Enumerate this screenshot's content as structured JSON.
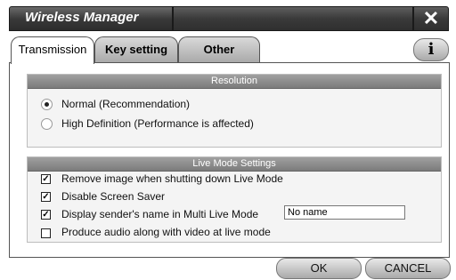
{
  "window": {
    "title": "Wireless Manager",
    "close_glyph": "✕"
  },
  "tabs": [
    {
      "label": "Transmission",
      "active": true
    },
    {
      "label": "Key setting",
      "active": false
    },
    {
      "label": "Other",
      "active": false
    }
  ],
  "info_glyph": "i",
  "resolution": {
    "header": "Resolution",
    "options": [
      {
        "label": "Normal (Recommendation)",
        "selected": true
      },
      {
        "label": "High Definition (Performance is affected)",
        "selected": false
      }
    ]
  },
  "live_mode": {
    "header": "Live Mode Settings",
    "options": [
      {
        "label": "Remove image when shutting down Live Mode",
        "checked": true
      },
      {
        "label": "Disable Screen Saver",
        "checked": true
      },
      {
        "label": "Display sender's name in Multi Live Mode",
        "checked": true
      },
      {
        "label": "Produce audio along with video at live mode",
        "checked": false
      }
    ],
    "name_value": "No name"
  },
  "buttons": {
    "ok": "OK",
    "cancel": "CANCEL"
  }
}
